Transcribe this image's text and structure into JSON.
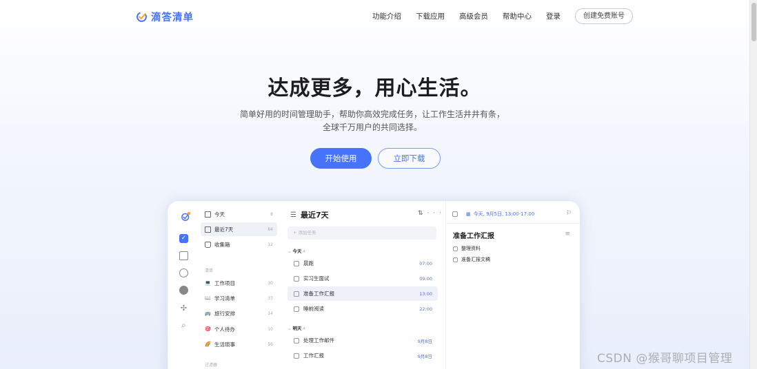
{
  "brand": {
    "name": "滴答清单",
    "color": "#4772fa"
  },
  "nav": {
    "items": [
      "功能介绍",
      "下载应用",
      "高级会员",
      "帮助中心",
      "登录"
    ],
    "signup": "创建免费账号"
  },
  "hero": {
    "title": "达成更多，用心生活。",
    "subtitle_line1": "简单好用的时间管理助手，帮助你高效完成任务，让工作生活井井有条，",
    "subtitle_line2": "全球千万用户的共同选择。",
    "primary_button": "开始使用",
    "secondary_button": "立即下载"
  },
  "app": {
    "smart_lists": [
      {
        "label": "今天",
        "count": "8",
        "icon": "calendar-today-icon"
      },
      {
        "label": "最近7天",
        "count": "84",
        "icon": "calendar-week-icon"
      },
      {
        "label": "收集箱",
        "count": "12",
        "icon": "inbox-icon"
      }
    ],
    "lists_header": "清单",
    "lists": [
      {
        "label": "工作项目",
        "count": "30",
        "emoji": "💻"
      },
      {
        "label": "学习清单",
        "count": "37",
        "emoji": "📖"
      },
      {
        "label": "旅行安排",
        "count": "14",
        "emoji": "🚌"
      },
      {
        "label": "个人待办",
        "count": "10",
        "emoji": "🎯"
      },
      {
        "label": "生活琐事",
        "count": "56",
        "emoji": "🌈"
      }
    ],
    "filters_header": "过滤器",
    "task_pane": {
      "title": "最近7天",
      "add_placeholder": "+ 添加任务",
      "group_today": "今天",
      "group_today_count": "4",
      "group_tomorrow": "明天",
      "group_tomorrow_count": "4",
      "today_tasks": [
        {
          "title": "晨跑",
          "due": "07:00"
        },
        {
          "title": "实习生面试",
          "due": "09:00"
        },
        {
          "title": "准备工作汇报",
          "due": "13:00"
        },
        {
          "title": "睡前阅读",
          "due": "22:00"
        }
      ],
      "tomorrow_tasks": [
        {
          "title": "处理工作邮件",
          "due": "9月8日"
        },
        {
          "title": "工作汇报",
          "due": "9月8日"
        }
      ]
    },
    "detail": {
      "date": "今天, 9月5日, 13:00-17:00",
      "title": "准备工作汇报",
      "subtasks": [
        "整理资料",
        "准备汇报文稿"
      ]
    }
  },
  "watermark": "CSDN @猴哥聊项目管理"
}
